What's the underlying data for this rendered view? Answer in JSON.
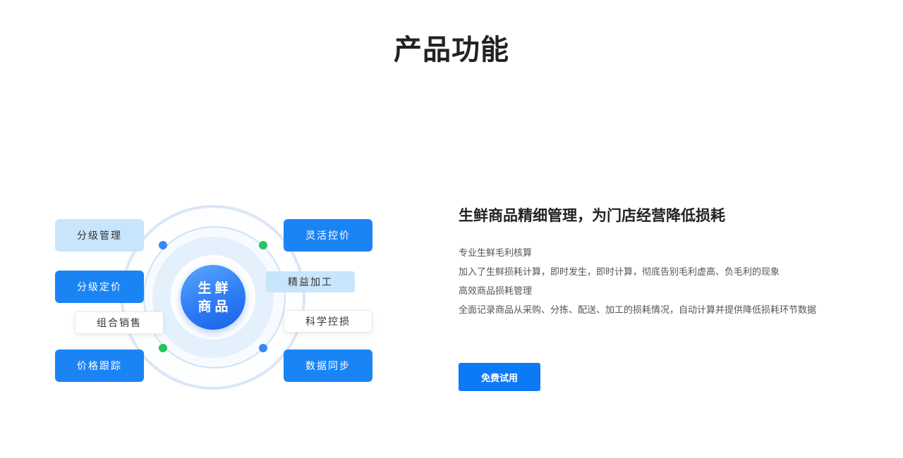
{
  "section": {
    "title": "产品功能"
  },
  "diagram": {
    "center_label": "生鲜商品",
    "tags": [
      "分级管理",
      "灵活控价",
      "分级定价",
      "精益加工",
      "组合销售",
      "科学控损",
      "价格跟踪",
      "数据同步"
    ]
  },
  "detail": {
    "heading": "生鲜商品精细管理，为门店经营降低损耗",
    "lines": [
      "专业生鲜毛利核算",
      "加入了生鲜损耗计算，即时发生，即时计算，彻底告别毛利虚高、负毛利的现象",
      "高效商品损耗管理",
      "全面记录商品从采购、分拣、配送、加工的损耗情况，自动计算并提供降低损耗环节数据"
    ],
    "cta_label": "免费试用"
  },
  "colors": {
    "brand_blue": "#1b84f5",
    "button_blue": "#0c7af5",
    "pale_blue": "#c8e5fb",
    "dot_green": "#22c55e",
    "dot_blue": "#3b86f2"
  }
}
